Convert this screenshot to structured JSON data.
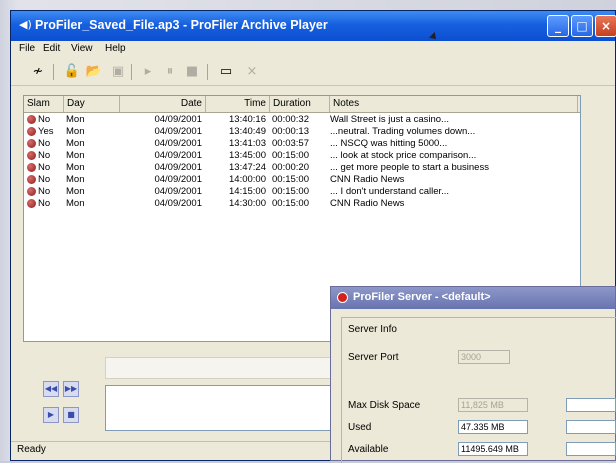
{
  "window": {
    "title": "ProFiler_Saved_File.ap3 - ProFiler Archive Player",
    "controls": {
      "minimize": "_",
      "maximize": "□",
      "close": "×"
    }
  },
  "menu": [
    "File",
    "Edit",
    "View",
    "Help"
  ],
  "toolbar": {
    "icons": [
      "graph-icon",
      "open-lock-icon",
      "open-folder-icon",
      "save-icon",
      "play-icon",
      "pause-icon",
      "stop-icon",
      "record-icon",
      "close-icon"
    ]
  },
  "list": {
    "columns": [
      "Slam",
      "Day",
      "Date",
      "Time",
      "Duration",
      "Notes"
    ],
    "rows": [
      {
        "slam": "No",
        "day": "Mon",
        "date": "04/09/2001",
        "time": "13:40:16",
        "duration": "00:00:32",
        "notes": "Wall Street is just a casino..."
      },
      {
        "slam": "Yes",
        "day": "Mon",
        "date": "04/09/2001",
        "time": "13:40:49",
        "duration": "00:00:13",
        "notes": "...neutral.  Trading volumes down..."
      },
      {
        "slam": "No",
        "day": "Mon",
        "date": "04/09/2001",
        "time": "13:41:03",
        "duration": "00:03:57",
        "notes": "... NSCQ was hitting 5000..."
      },
      {
        "slam": "No",
        "day": "Mon",
        "date": "04/09/2001",
        "time": "13:45:00",
        "duration": "00:15:00",
        "notes": "... look at stock price comparison..."
      },
      {
        "slam": "No",
        "day": "Mon",
        "date": "04/09/2001",
        "time": "13:47:24",
        "duration": "00:00:20",
        "notes": "... get more people to start a business"
      },
      {
        "slam": "No",
        "day": "Mon",
        "date": "04/09/2001",
        "time": "14:00:00",
        "duration": "00:15:00",
        "notes": "CNN Radio News"
      },
      {
        "slam": "No",
        "day": "Mon",
        "date": "04/09/2001",
        "time": "14:15:00",
        "duration": "00:15:00",
        "notes": "... I don't understand caller..."
      },
      {
        "slam": "No",
        "day": "Mon",
        "date": "04/09/2001",
        "time": "14:30:00",
        "duration": "00:15:00",
        "notes": "CNN Radio News"
      }
    ]
  },
  "status": {
    "text": "Ready"
  },
  "server": {
    "title": "ProFiler Server - <default>",
    "group_label": "Server Info",
    "port_label": "Server Port",
    "port_value": "3000",
    "max_disk_label": "Max Disk Space",
    "max_disk_value": "11,825 MB",
    "used_label": "Used",
    "used_value": "47.335 MB",
    "available_label": "Available",
    "available_value": "11495.649 MB"
  }
}
